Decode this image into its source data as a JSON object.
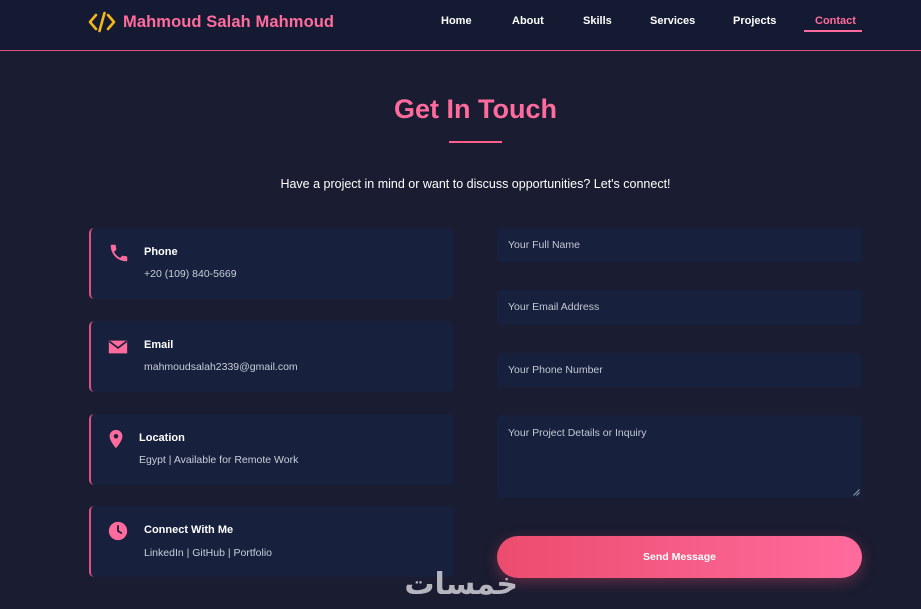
{
  "header": {
    "brand": "Mahmoud Salah Mahmoud",
    "brand_icon": "code-icon",
    "nav": [
      {
        "label": "Home",
        "active": false
      },
      {
        "label": "About",
        "active": false
      },
      {
        "label": "Skills",
        "active": false
      },
      {
        "label": "Services",
        "active": false
      },
      {
        "label": "Projects",
        "active": false
      },
      {
        "label": "Contact",
        "active": true
      }
    ]
  },
  "section": {
    "title": "Get In Touch",
    "subtitle": "Have a project in mind or want to discuss opportunities? Let's connect!"
  },
  "contact_cards": [
    {
      "icon": "phone-icon",
      "title": "Phone",
      "value": "+20 (109) 840-5669"
    },
    {
      "icon": "envelope-icon",
      "title": "Email",
      "value": "mahmoudsalah2339@gmail.com"
    },
    {
      "icon": "location-pin-icon",
      "title": "Location",
      "value": "Egypt | Available for Remote Work"
    },
    {
      "icon": "clock-icon",
      "title": "Connect With Me",
      "value": "LinkedIn | GitHub | Portfolio"
    }
  ],
  "form": {
    "name_placeholder": "Your Full Name",
    "email_placeholder": "Your Email Address",
    "phone_placeholder": "Your Phone Number",
    "message_placeholder": "Your Project Details or Inquiry",
    "submit_label": "Send Message"
  },
  "watermark": "خمسات",
  "colors": {
    "background": "#1a1c31",
    "navbar": "#151a33",
    "card": "#17213d",
    "accent": "#ff6b9d",
    "brand_icon": "#f5b61a"
  }
}
